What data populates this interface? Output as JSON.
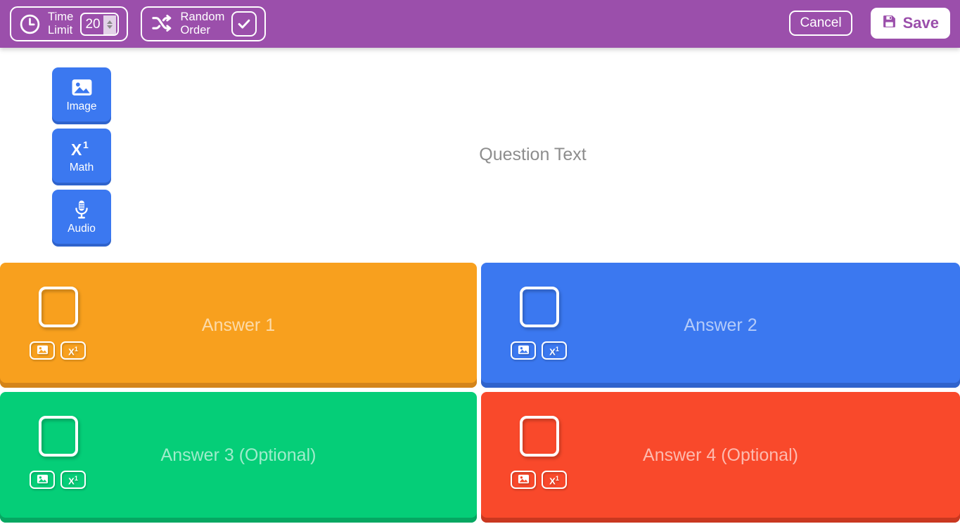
{
  "header": {
    "time_limit": {
      "label": "Time\nLimit",
      "icon": "clock-icon",
      "value": "20"
    },
    "random_order": {
      "label": "Random\nOrder",
      "icon": "shuffle-icon",
      "checked": true
    },
    "cancel_label": "Cancel",
    "save_label": "Save",
    "save_icon": "floppy-disk-icon",
    "background_color": "#9b4fab",
    "save_text_color": "#9b4fab"
  },
  "tools": [
    {
      "label": "Image",
      "icon": "image-icon"
    },
    {
      "label": "Math",
      "icon": "math-x1-icon"
    },
    {
      "label": "Audio",
      "icon": "microphone-icon"
    }
  ],
  "question": {
    "placeholder": "Question Text"
  },
  "answers": [
    {
      "placeholder": "Answer 1",
      "color": "#f8a01e",
      "shadow_color": "#d4841a",
      "checked": false,
      "image_icon": "image-icon",
      "math_icon": "math-x1-icon"
    },
    {
      "placeholder": "Answer 2",
      "color": "#3b78f0",
      "shadow_color": "#2f63cc",
      "checked": false,
      "image_icon": "image-icon",
      "math_icon": "math-x1-icon"
    },
    {
      "placeholder": "Answer 3 (Optional)",
      "color": "#05ce78",
      "shadow_color": "#06a762",
      "checked": false,
      "image_icon": "image-icon",
      "math_icon": "math-x1-icon"
    },
    {
      "placeholder": "Answer 4 (Optional)",
      "color": "#f9492b",
      "shadow_color": "#c93820",
      "checked": false,
      "image_icon": "image-icon",
      "math_icon": "math-x1-icon"
    }
  ]
}
